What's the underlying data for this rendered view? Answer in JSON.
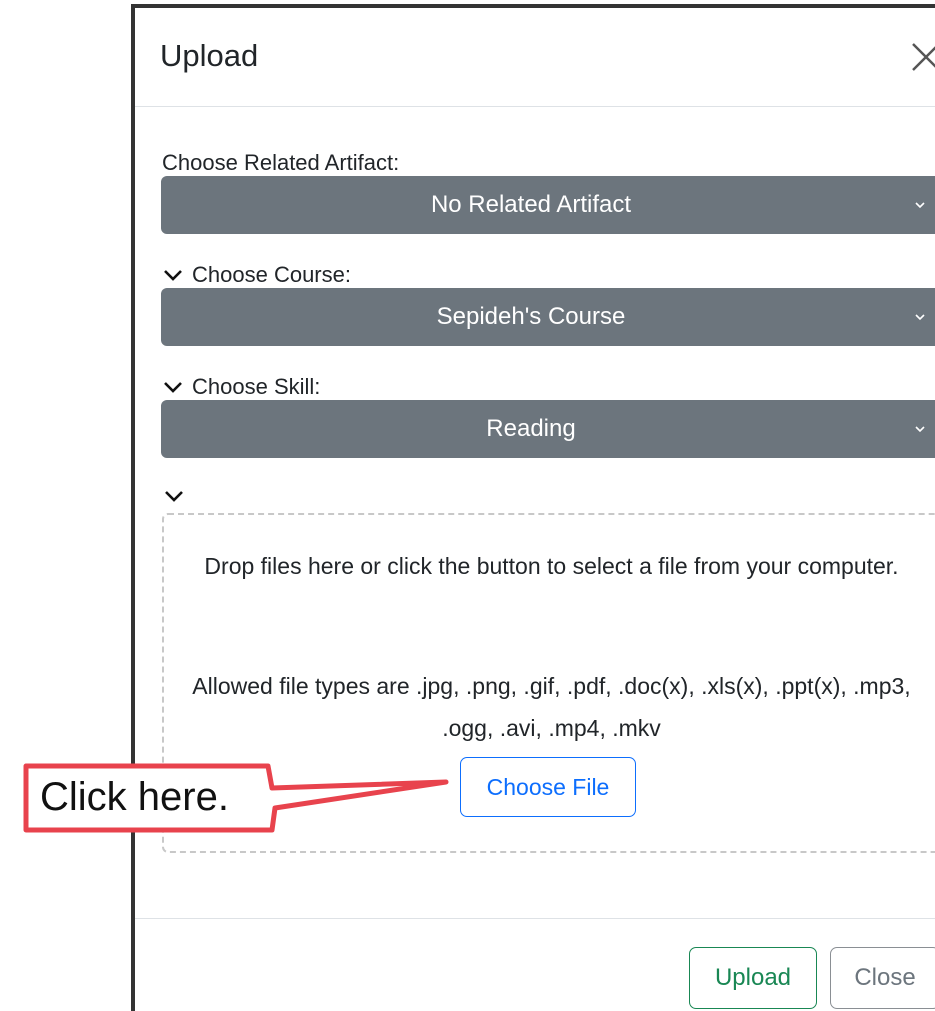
{
  "modal": {
    "title": "Upload",
    "close_icon": "close-x-icon"
  },
  "fields": {
    "artifact": {
      "label": "Choose Related Artifact:",
      "selected": "No Related Artifact"
    },
    "course": {
      "label": "Choose Course:",
      "selected": "Sepideh's Course"
    },
    "skill": {
      "label": "Choose Skill:",
      "selected": "Reading"
    }
  },
  "dropzone": {
    "instruction": "Drop files here or click the button to select a file from your computer.",
    "allowed_types": "Allowed file types are .jpg, .png, .gif, .pdf, .doc(x), .xls(x), .ppt(x), .mp3, .ogg, .avi, .mp4, .mkv",
    "choose_button": "Choose File"
  },
  "footer": {
    "upload_label": "Upload",
    "close_label": "Close"
  },
  "annotation": {
    "callout_text": "Click here."
  },
  "colors": {
    "select_bg": "#6c757d",
    "primary": "#0d6efd",
    "success": "#198754",
    "secondary": "#6c757d",
    "callout_border": "#e8434d"
  }
}
